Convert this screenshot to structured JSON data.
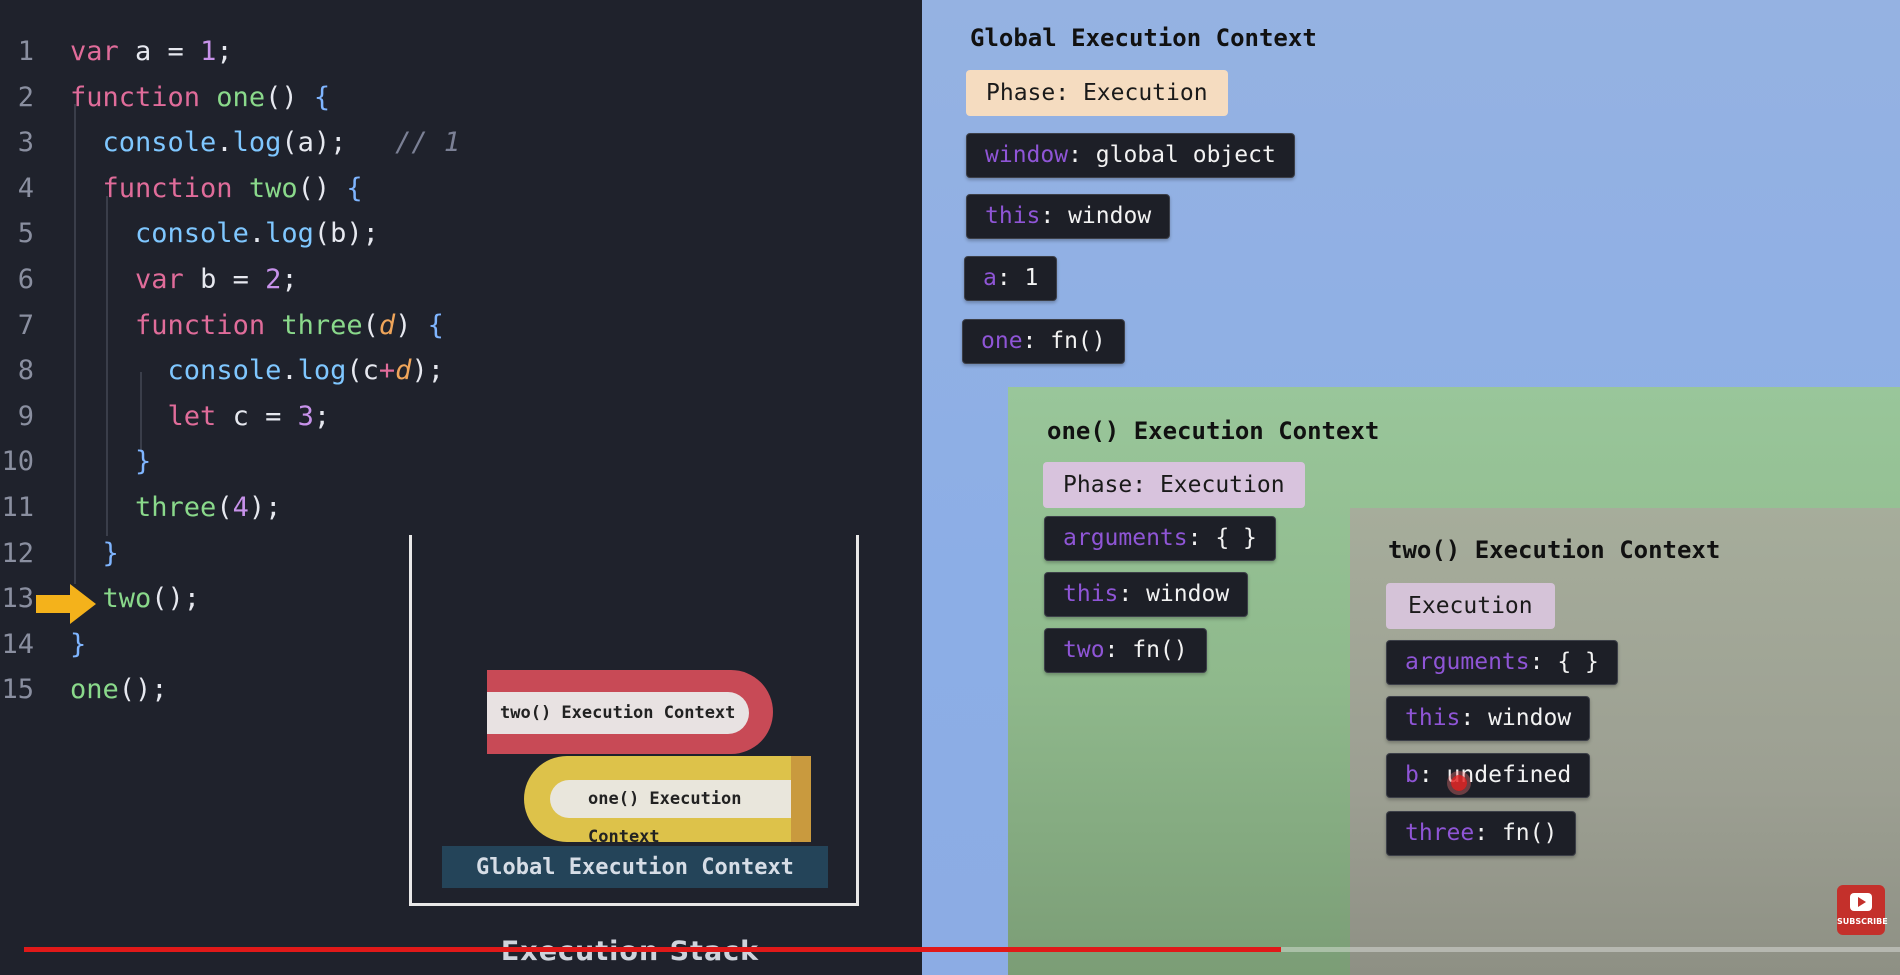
{
  "code_panel": {
    "lines": [
      {
        "n": "1",
        "tokens": [
          [
            "kw",
            "var"
          ],
          [
            "",
            " a = "
          ],
          [
            "num",
            "1"
          ],
          [
            "",
            ";"
          ]
        ]
      },
      {
        "n": "2",
        "tokens": [
          [
            "kw",
            "function"
          ],
          [
            "",
            ""
          ],
          [
            "fn",
            " one"
          ],
          [
            "",
            "() "
          ],
          [
            "br",
            "{"
          ]
        ]
      },
      {
        "n": "3",
        "tokens": [
          [
            "",
            "  "
          ],
          [
            "prop",
            "console"
          ],
          [
            "",
            "."
          ],
          [
            "prop",
            "log"
          ],
          [
            "",
            "(a);"
          ],
          [
            "cm",
            "   // 1"
          ]
        ]
      },
      {
        "n": "4",
        "tokens": [
          [
            "",
            "  "
          ],
          [
            "kw",
            "function"
          ],
          [
            "fn",
            " two"
          ],
          [
            "",
            "() "
          ],
          [
            "br",
            "{"
          ]
        ]
      },
      {
        "n": "5",
        "tokens": [
          [
            "",
            "    "
          ],
          [
            "prop",
            "console"
          ],
          [
            "",
            "."
          ],
          [
            "prop",
            "log"
          ],
          [
            "",
            "(b);"
          ]
        ]
      },
      {
        "n": "6",
        "tokens": [
          [
            "",
            "    "
          ],
          [
            "kw",
            "var"
          ],
          [
            "",
            " b = "
          ],
          [
            "num",
            "2"
          ],
          [
            "",
            ";"
          ]
        ]
      },
      {
        "n": "7",
        "tokens": [
          [
            "",
            "    "
          ],
          [
            "kw",
            "function"
          ],
          [
            "fn",
            " three"
          ],
          [
            "",
            "("
          ],
          [
            "par",
            "d"
          ],
          [
            "",
            ") "
          ],
          [
            "br",
            "{"
          ]
        ]
      },
      {
        "n": "8",
        "tokens": [
          [
            "",
            "      "
          ],
          [
            "prop",
            "console"
          ],
          [
            "",
            "."
          ],
          [
            "prop",
            "log"
          ],
          [
            "",
            "(c"
          ],
          [
            "kw",
            "+"
          ],
          [
            "par",
            "d"
          ],
          [
            "",
            ");"
          ]
        ]
      },
      {
        "n": "9",
        "tokens": [
          [
            "",
            "      "
          ],
          [
            "kw",
            "let"
          ],
          [
            "",
            " c = "
          ],
          [
            "num",
            "3"
          ],
          [
            "",
            ";"
          ]
        ]
      },
      {
        "n": "10",
        "tokens": [
          [
            "",
            "    "
          ],
          [
            "br",
            "}"
          ]
        ]
      },
      {
        "n": "11",
        "tokens": [
          [
            "",
            "    "
          ],
          [
            "fn",
            "three"
          ],
          [
            "",
            "("
          ],
          [
            "num",
            "4"
          ],
          [
            "",
            ");"
          ]
        ]
      },
      {
        "n": "12",
        "tokens": [
          [
            "",
            "  "
          ],
          [
            "br",
            "}"
          ]
        ]
      },
      {
        "n": "13",
        "tokens": [
          [
            "",
            "  "
          ],
          [
            "fn",
            "two"
          ],
          [
            "",
            "();"
          ]
        ]
      },
      {
        "n": "14",
        "tokens": [
          [
            "br",
            "}"
          ]
        ]
      },
      {
        "n": "15",
        "tokens": [
          [
            "fn",
            "one"
          ],
          [
            "",
            "();"
          ]
        ]
      }
    ],
    "current_line": "13"
  },
  "execution_stack": {
    "title": "Execution Stack",
    "frames": {
      "two": "two() Execution Context",
      "one": "one() Execution Context",
      "global": "Global Execution Context"
    }
  },
  "global_ctx": {
    "title": "Global Execution Context",
    "phase_key": "Phase:",
    "phase_val": " Execution",
    "rows": [
      {
        "k": "window",
        "v": ": global object"
      },
      {
        "k": "this",
        "v": ": window"
      },
      {
        "k": "a",
        "v": ": 1"
      },
      {
        "k": "one",
        "v": ": fn()"
      }
    ]
  },
  "one_ctx": {
    "title": "one() Execution Context",
    "phase_key": "Phase:",
    "phase_val": " Execution",
    "rows": [
      {
        "k": "arguments",
        "v": ": { }"
      },
      {
        "k": "this",
        "v": ": window"
      },
      {
        "k": "two",
        "v": ": fn()"
      }
    ]
  },
  "two_ctx": {
    "title": "two() Execution Context",
    "phase_val": "Execution",
    "rows": [
      {
        "k": "arguments",
        "v": ": { }"
      },
      {
        "k": "this",
        "v": ": window"
      },
      {
        "k": "b",
        "v": ": undefined"
      },
      {
        "k": "three",
        "v": ": fn()"
      }
    ]
  },
  "colors": {
    "code_bg": "#1f222c",
    "keyword": "#e06c9a",
    "function": "#8ad98b",
    "global_zone": "#8caee6",
    "one_zone": "#99c69a",
    "two_zone": "#a6ad9b",
    "progress": "#e01919",
    "arrow": "#f4b21b"
  },
  "video": {
    "progress_fraction": 0.67
  },
  "subscribe_label": "SUBSCRIBE"
}
